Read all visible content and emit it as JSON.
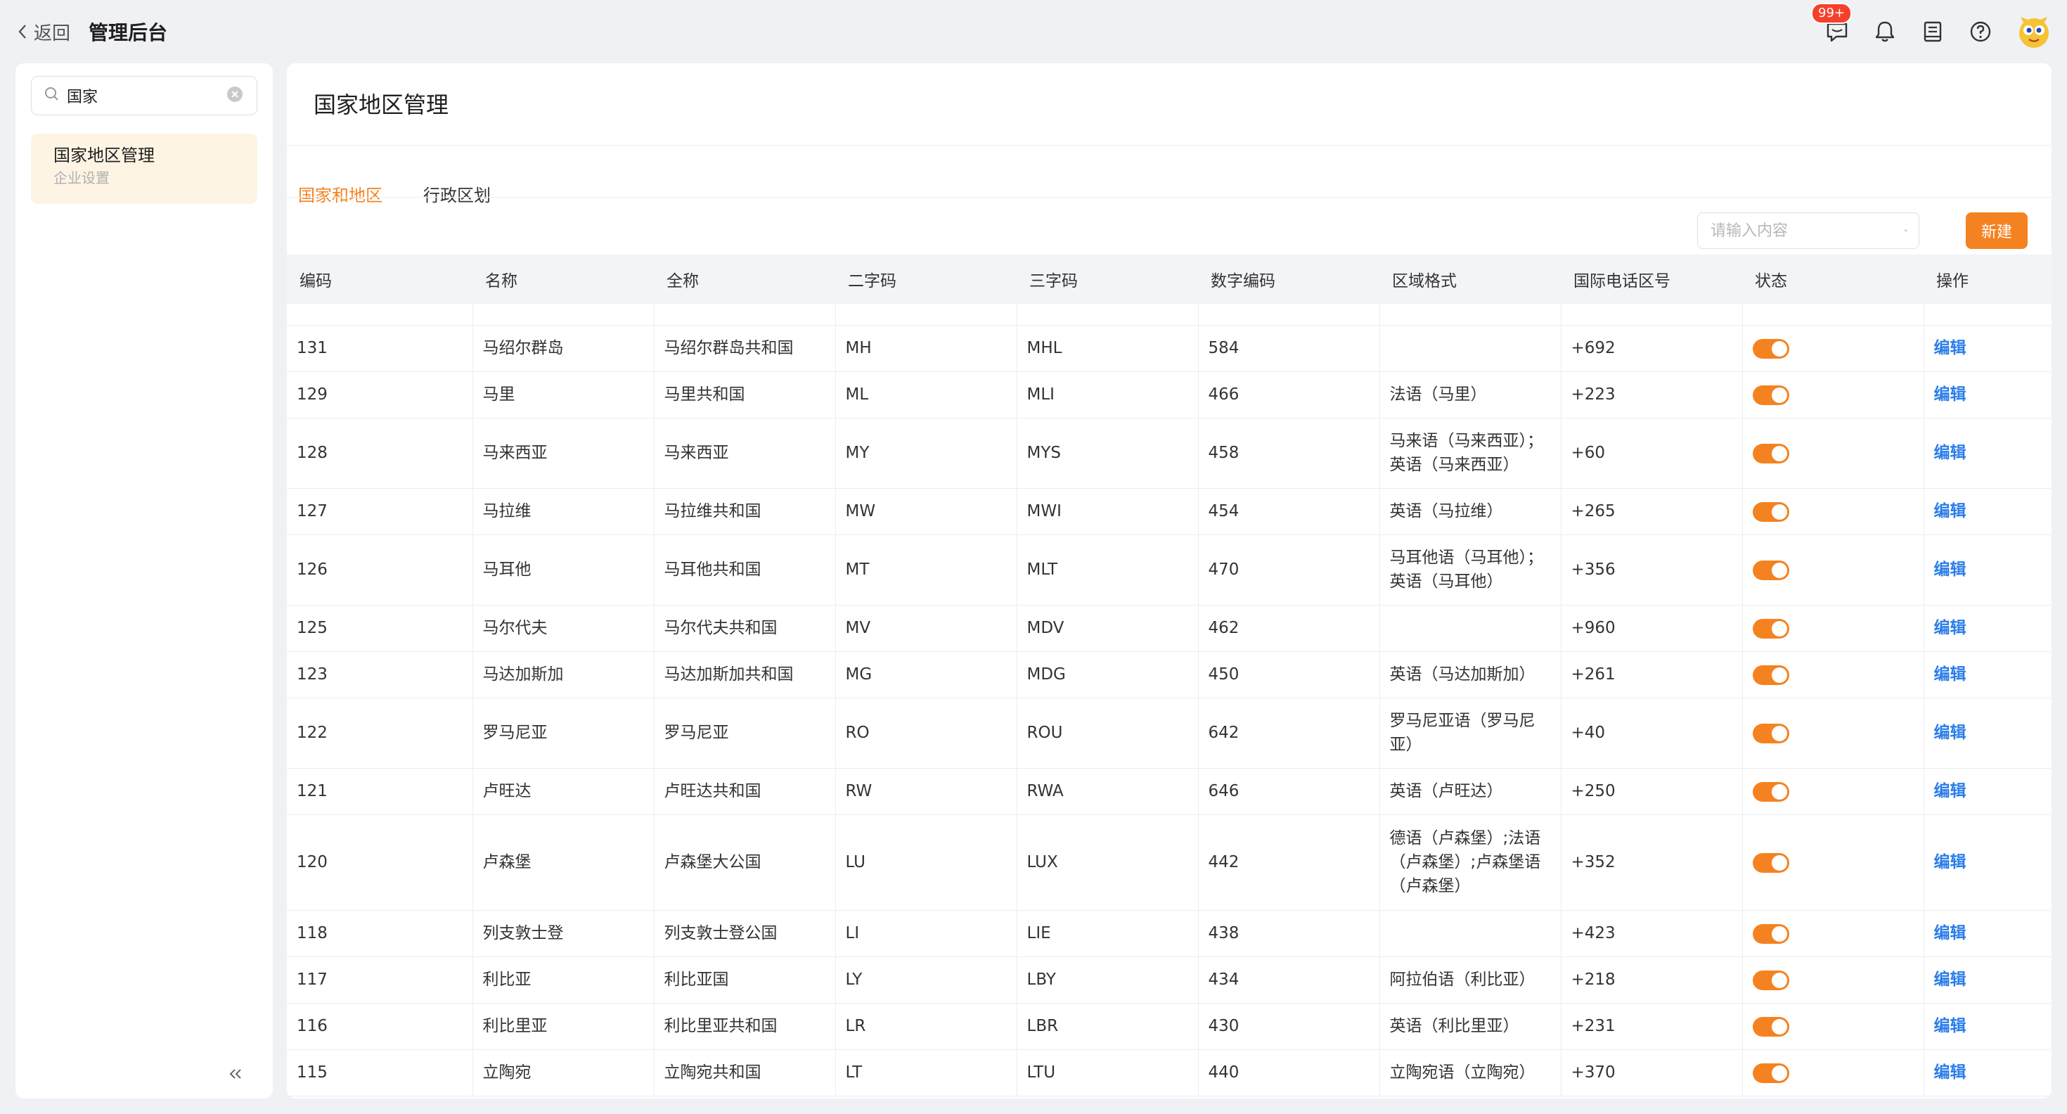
{
  "topbar": {
    "back_label": "返回",
    "title": "管理后台",
    "notification_badge": "99+"
  },
  "sidebar": {
    "search_value": "国家",
    "items": [
      {
        "label": "国家地区管理",
        "sub": "企业设置"
      }
    ]
  },
  "main": {
    "page_title": "国家地区管理",
    "tabs": [
      {
        "label": "国家和地区",
        "active": true
      },
      {
        "label": "行政区划",
        "active": false
      }
    ],
    "search_placeholder": "请输入内容",
    "new_button": "新建",
    "columns": [
      "编码",
      "名称",
      "全称",
      "二字码",
      "三字码",
      "数字编码",
      "区域格式",
      "国际电话区号",
      "状态",
      "操作"
    ],
    "edit_label": "编辑",
    "rows": [
      {
        "code": "131",
        "name": "马绍尔群岛",
        "full": "马绍尔群岛共和国",
        "a2": "MH",
        "a3": "MHL",
        "num": "584",
        "fmt": "",
        "tel": "+692",
        "enabled": true
      },
      {
        "code": "129",
        "name": "马里",
        "full": "马里共和国",
        "a2": "ML",
        "a3": "MLI",
        "num": "466",
        "fmt": "法语（马里）",
        "tel": "+223",
        "enabled": true
      },
      {
        "code": "128",
        "name": "马来西亚",
        "full": "马来西亚",
        "a2": "MY",
        "a3": "MYS",
        "num": "458",
        "fmt": "马来语（马来西亚）；英语（马来西亚）",
        "tel": "+60",
        "enabled": true
      },
      {
        "code": "127",
        "name": "马拉维",
        "full": "马拉维共和国",
        "a2": "MW",
        "a3": "MWI",
        "num": "454",
        "fmt": "英语（马拉维）",
        "tel": "+265",
        "enabled": true
      },
      {
        "code": "126",
        "name": "马耳他",
        "full": "马耳他共和国",
        "a2": "MT",
        "a3": "MLT",
        "num": "470",
        "fmt": "马耳他语（马耳他）；英语（马耳他）",
        "tel": "+356",
        "enabled": true
      },
      {
        "code": "125",
        "name": "马尔代夫",
        "full": "马尔代夫共和国",
        "a2": "MV",
        "a3": "MDV",
        "num": "462",
        "fmt": "",
        "tel": "+960",
        "enabled": true
      },
      {
        "code": "123",
        "name": "马达加斯加",
        "full": "马达加斯加共和国",
        "a2": "MG",
        "a3": "MDG",
        "num": "450",
        "fmt": "英语（马达加斯加）",
        "tel": "+261",
        "enabled": true
      },
      {
        "code": "122",
        "name": "罗马尼亚",
        "full": "罗马尼亚",
        "a2": "RO",
        "a3": "ROU",
        "num": "642",
        "fmt": "罗马尼亚语（罗马尼亚）",
        "tel": "+40",
        "enabled": true
      },
      {
        "code": "121",
        "name": "卢旺达",
        "full": "卢旺达共和国",
        "a2": "RW",
        "a3": "RWA",
        "num": "646",
        "fmt": "英语（卢旺达）",
        "tel": "+250",
        "enabled": true
      },
      {
        "code": "120",
        "name": "卢森堡",
        "full": "卢森堡大公国",
        "a2": "LU",
        "a3": "LUX",
        "num": "442",
        "fmt": "德语（卢森堡）;法语（卢森堡）;卢森堡语（卢森堡）",
        "tel": "+352",
        "enabled": true
      },
      {
        "code": "118",
        "name": "列支敦士登",
        "full": "列支敦士登公国",
        "a2": "LI",
        "a3": "LIE",
        "num": "438",
        "fmt": "",
        "tel": "+423",
        "enabled": true
      },
      {
        "code": "117",
        "name": "利比亚",
        "full": "利比亚国",
        "a2": "LY",
        "a3": "LBY",
        "num": "434",
        "fmt": "阿拉伯语（利比亚）",
        "tel": "+218",
        "enabled": true
      },
      {
        "code": "116",
        "name": "利比里亚",
        "full": "利比里亚共和国",
        "a2": "LR",
        "a3": "LBR",
        "num": "430",
        "fmt": "英语（利比里亚）",
        "tel": "+231",
        "enabled": true
      },
      {
        "code": "115",
        "name": "立陶宛",
        "full": "立陶宛共和国",
        "a2": "LT",
        "a3": "LTU",
        "num": "440",
        "fmt": "立陶宛语（立陶宛）",
        "tel": "+370",
        "enabled": true
      }
    ]
  }
}
